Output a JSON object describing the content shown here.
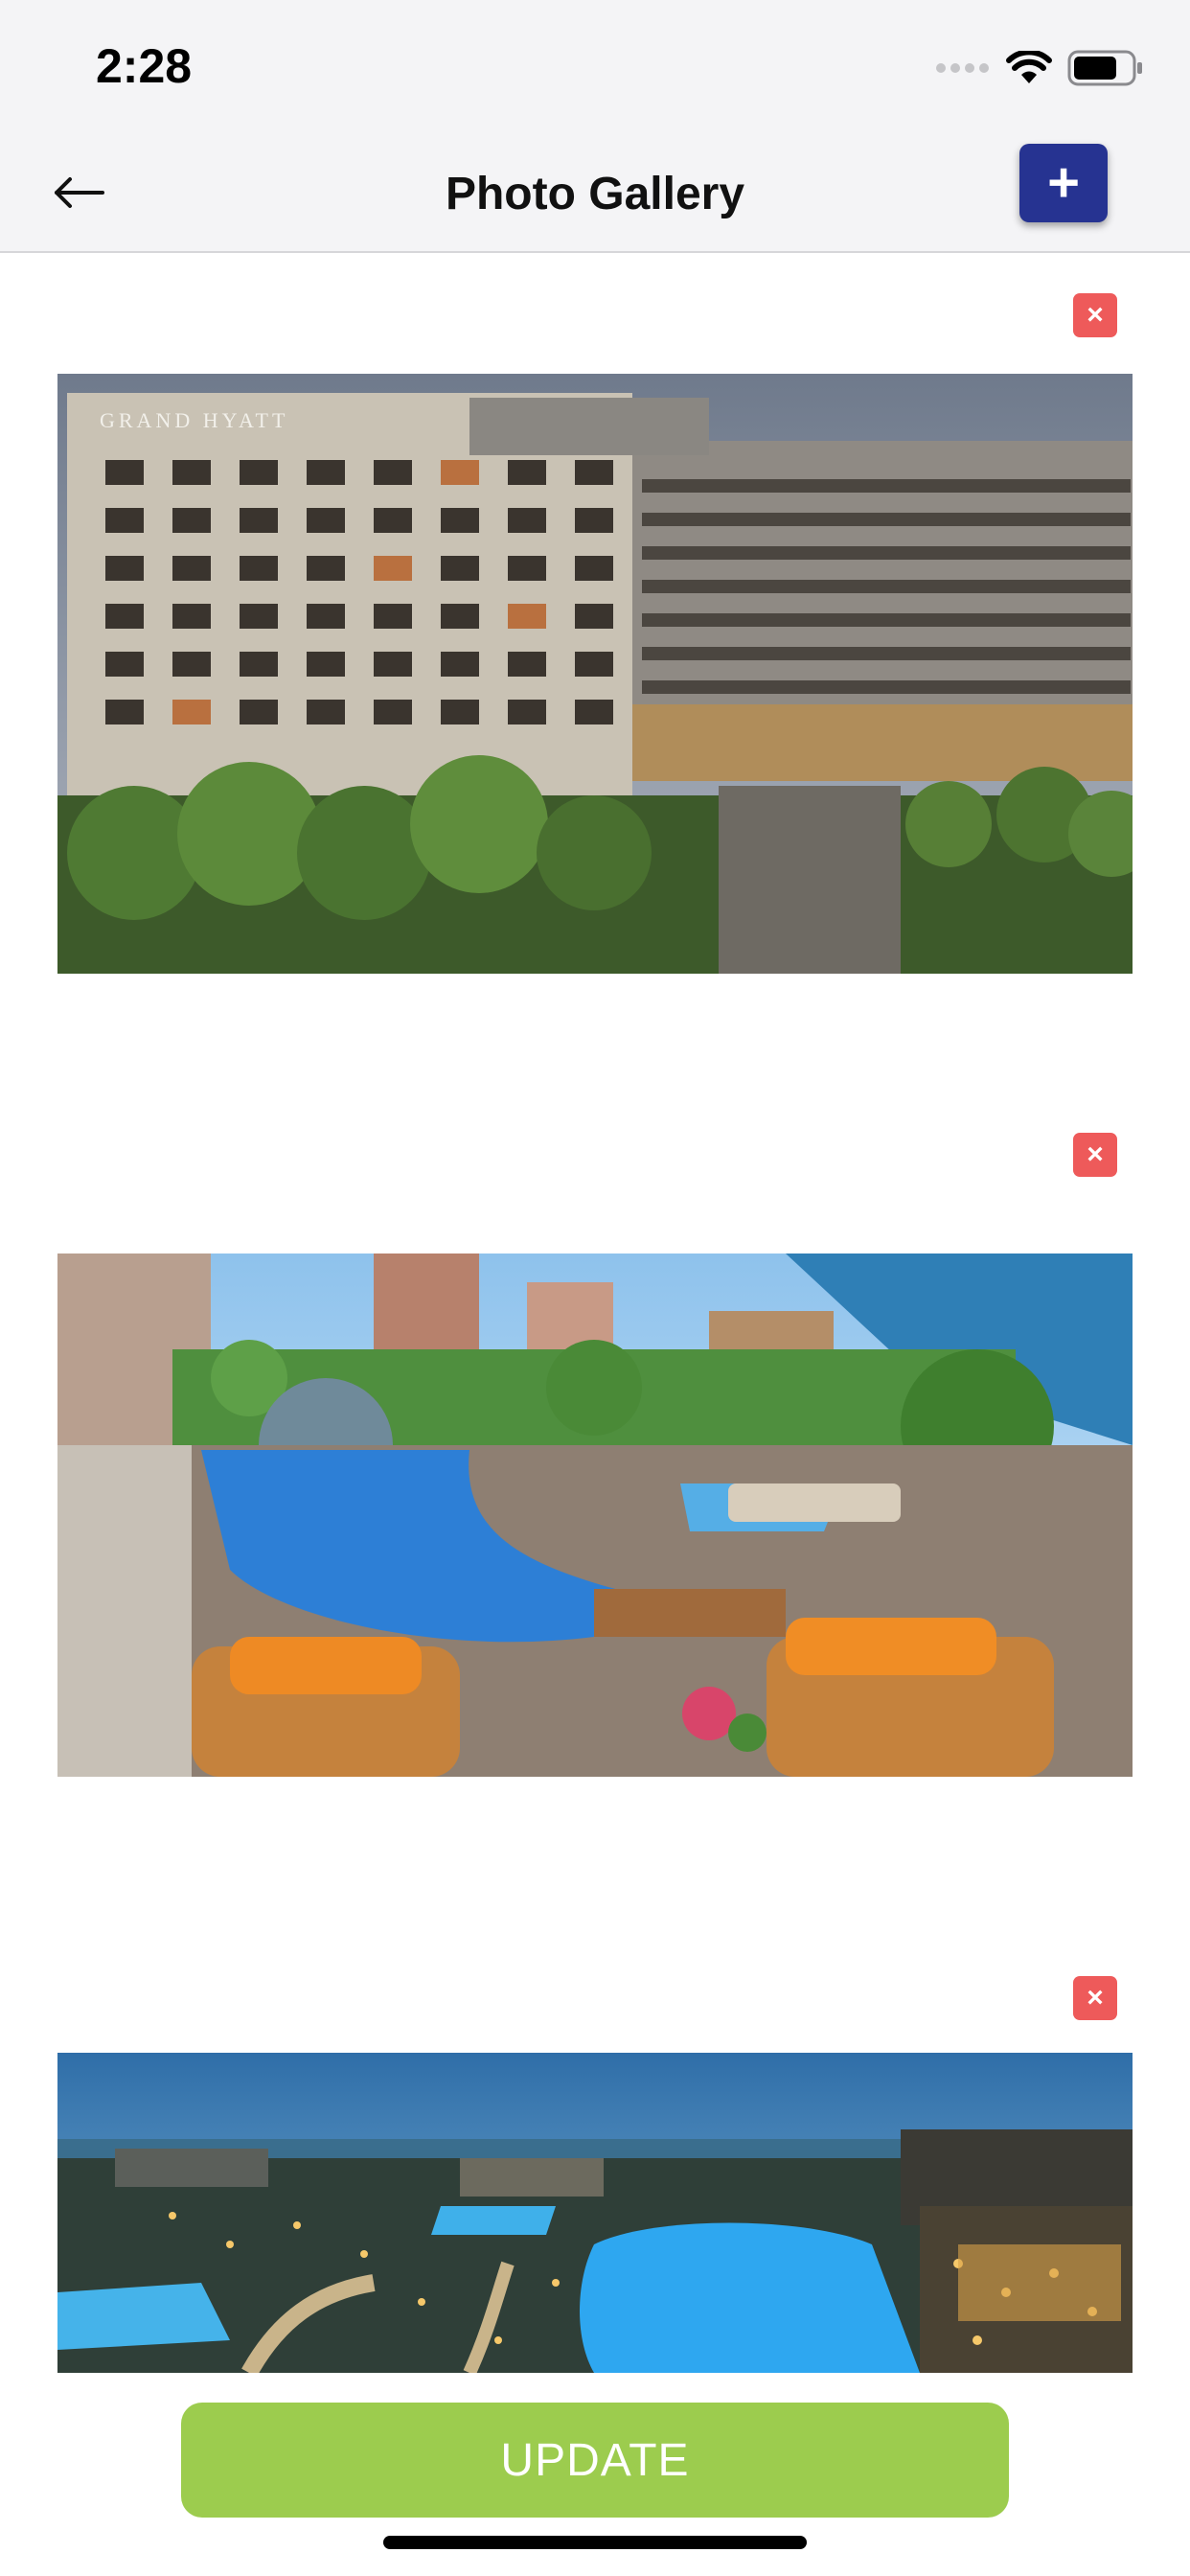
{
  "status_bar": {
    "time": "2:28",
    "icons": [
      "signal-dots-icon",
      "wifi-icon",
      "battery-icon"
    ]
  },
  "header": {
    "title": "Photo Gallery",
    "back_icon": "arrow-left-icon",
    "add_label": "+"
  },
  "gallery": {
    "delete_label": "×",
    "photos": [
      {
        "name": "hotel-building-photo",
        "sign_text": "GRAND HYATT"
      },
      {
        "name": "pool-terrace-photo"
      },
      {
        "name": "resort-night-pool-photo"
      }
    ]
  },
  "footer": {
    "update_label": "UPDATE"
  },
  "colors": {
    "accent": "#263391",
    "delete": "#ee5a5a",
    "update": "#9ccc4e",
    "header_bg": "#f4f4f6"
  }
}
